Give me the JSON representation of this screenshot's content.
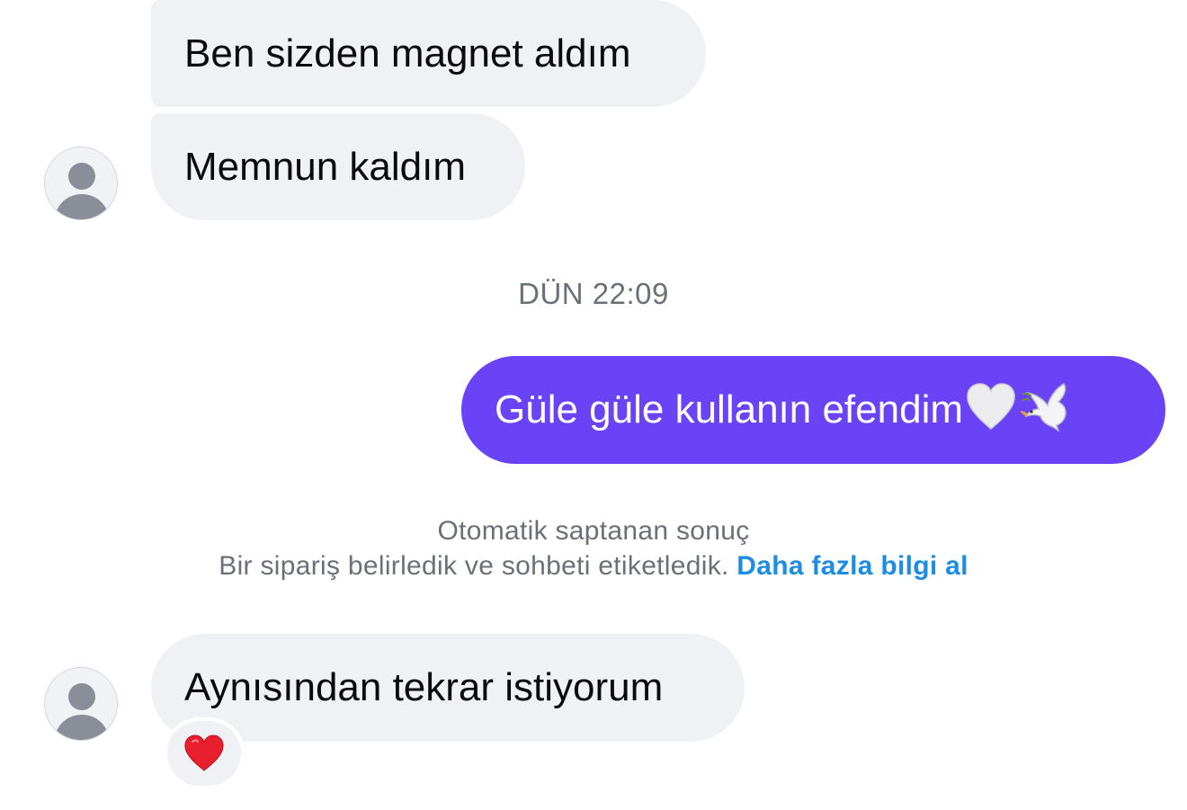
{
  "messages": [
    {
      "direction": "incoming",
      "text": "Ben sizden magnet aldım"
    },
    {
      "direction": "incoming",
      "text": "Memnun kaldım"
    },
    {
      "direction": "outgoing",
      "text": "Güle güle kullanın efendim",
      "emojis": [
        "white-heart-icon",
        "dove-icon"
      ]
    },
    {
      "direction": "incoming",
      "text": "Aynısından tekrar istiyorum",
      "reaction": "red-heart-icon"
    }
  ],
  "timestamp": "DÜN 22:09",
  "notice": {
    "title": "Otomatik saptanan sonuç",
    "text": "Bir sipariş belirledik ve sohbeti etiketledik.",
    "link": "Daha fazla bilgi al"
  },
  "colors": {
    "incoming_bubble": "#f0f1f4",
    "outgoing_bubble": "#6a43f6",
    "link": "#1d8de3",
    "muted_text": "#6b6f7a"
  }
}
